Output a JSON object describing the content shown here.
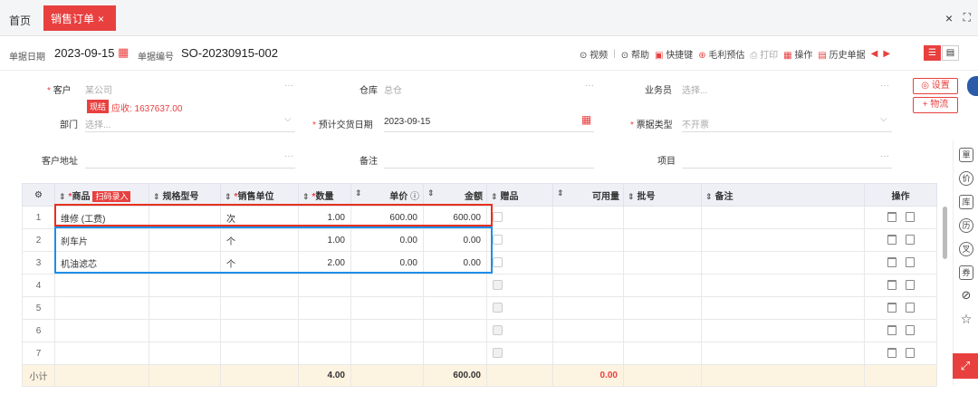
{
  "tabs": {
    "home": "首页",
    "active": "销售订单",
    "active_close": "×"
  },
  "window": {
    "close": "×",
    "fullscreen": "⛶"
  },
  "infobar": {
    "date_label": "单据日期",
    "date_value": "2023-09-15",
    "no_label": "单据编号",
    "no_value": "SO-20230915-002",
    "toolbar": [
      "视频",
      "帮助",
      "快捷键",
      "毛利预估",
      "打印",
      "操作",
      "历史单据"
    ],
    "sep": "|"
  },
  "form": {
    "customer_label": "客户",
    "customer_placeholder": "某公司",
    "cash_badge": "现结",
    "receivable": "应收: 1637637.00",
    "warehouse_label": "仓库",
    "warehouse_placeholder": "总仓",
    "salesman_label": "业务员",
    "salesman_placeholder": "选择...",
    "settings_btn": "◎ 设置",
    "logistics_btn": "+ 物流",
    "dept_label": "部门",
    "dept_placeholder": "选择...",
    "delivery_label": "预计交货日期",
    "delivery_value": "2023-09-15",
    "invoice_label": "票据类型",
    "invoice_placeholder": "不开票",
    "address_label": "客户地址",
    "remark_label": "备注",
    "project_label": "项目",
    "dots": "···",
    "chev": "⌵",
    "req": "*"
  },
  "table": {
    "headers": [
      "⚙",
      "商品",
      "规格型号",
      "销售单位",
      "数量",
      "单价",
      "金额",
      "赠品",
      "可用量",
      "批号",
      "备注",
      "操作"
    ],
    "scan_badge": "扫码录入",
    "rows": [
      {
        "idx": "1",
        "product": "维修 (工费)",
        "unit": "次",
        "qty": "1.00",
        "price": "600.00",
        "amount": "600.00"
      },
      {
        "idx": "2",
        "product": "刹车片",
        "unit": "个",
        "qty": "1.00",
        "price": "0.00",
        "amount": "0.00"
      },
      {
        "idx": "3",
        "product": "机油滤芯",
        "unit": "个",
        "qty": "2.00",
        "price": "0.00",
        "amount": "0.00"
      },
      {
        "idx": "4",
        "product": "",
        "unit": "",
        "qty": "",
        "price": "",
        "amount": ""
      },
      {
        "idx": "5",
        "product": "",
        "unit": "",
        "qty": "",
        "price": "",
        "amount": ""
      },
      {
        "idx": "6",
        "product": "",
        "unit": "",
        "qty": "",
        "price": "",
        "amount": ""
      },
      {
        "idx": "7",
        "product": "",
        "unit": "",
        "qty": "",
        "price": "",
        "amount": ""
      }
    ],
    "subtotal": {
      "label": "小计",
      "qty": "4.00",
      "amount": "600.00",
      "available": "0.00"
    }
  },
  "rail": [
    "單",
    "价",
    "库",
    "历",
    "叉",
    "券",
    "⊘",
    "☆",
    "⤢"
  ],
  "colors": {
    "accent": "#e8403f",
    "highlight_red": "#e8301e",
    "highlight_blue": "#1e8ee8"
  }
}
